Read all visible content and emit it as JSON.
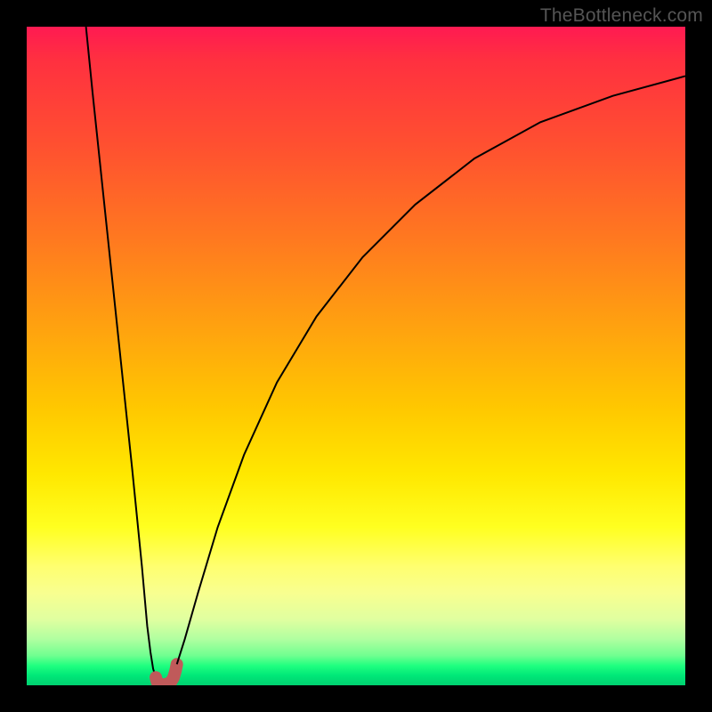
{
  "watermark": "TheBottleneck.com",
  "chart_data": {
    "type": "line",
    "title": "",
    "xlabel": "",
    "ylabel": "",
    "xlim": [
      0,
      100
    ],
    "ylim": [
      0,
      100
    ],
    "grid": false,
    "legend": false,
    "series": [
      {
        "name": "left-branch",
        "x": [
          9,
          10,
          12,
          14,
          16,
          17.5,
          18.3,
          18.8,
          19.2,
          19.6
        ],
        "y": [
          100,
          90,
          71,
          52,
          33,
          18,
          9,
          5,
          2.5,
          1.2
        ]
      },
      {
        "name": "dip-marker",
        "x": [
          19.6,
          19.8,
          20.2,
          20.7,
          21.3,
          21.9,
          22.3,
          22.6,
          22.8
        ],
        "y": [
          1.2,
          0.5,
          0.2,
          0.1,
          0.2,
          0.5,
          1.2,
          2.2,
          3.2
        ],
        "style": "thick-muted-red"
      },
      {
        "name": "right-branch",
        "x": [
          22.8,
          24,
          26,
          29,
          33,
          38,
          44,
          51,
          59,
          68,
          78,
          89,
          100
        ],
        "y": [
          3.2,
          7,
          14,
          24,
          35,
          46,
          56,
          65,
          73,
          80,
          85.5,
          89.5,
          92.5
        ]
      }
    ],
    "background_gradient": {
      "orientation": "vertical",
      "stops": [
        {
          "pos": 0.0,
          "color": "#FF1A52"
        },
        {
          "pos": 0.18,
          "color": "#FF5030"
        },
        {
          "pos": 0.45,
          "color": "#FFA010"
        },
        {
          "pos": 0.68,
          "color": "#FFE800"
        },
        {
          "pos": 0.86,
          "color": "#F8FF90"
        },
        {
          "pos": 0.97,
          "color": "#20FF80"
        },
        {
          "pos": 1.0,
          "color": "#00D070"
        }
      ]
    }
  }
}
